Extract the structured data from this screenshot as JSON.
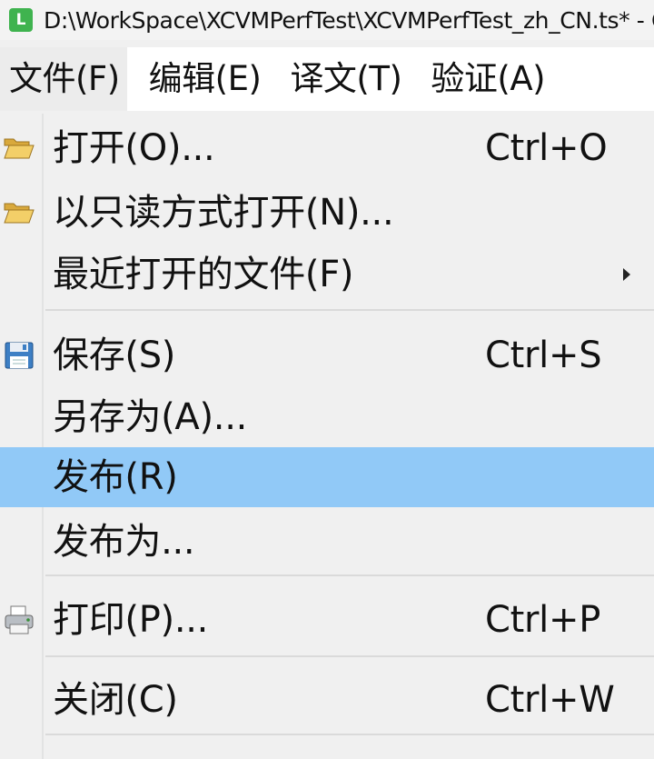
{
  "window": {
    "app_icon_letter": "L",
    "title": "D:\\WorkSpace\\XCVMPerfTest\\XCVMPerfTest_zh_CN.ts* - C"
  },
  "menubar": {
    "items": [
      {
        "label": "文件(F)"
      },
      {
        "label": "编辑(E)"
      },
      {
        "label": "译文(T)"
      },
      {
        "label": "验证(A)"
      }
    ]
  },
  "file_menu": {
    "items": [
      {
        "label": "打开(O)...",
        "shortcut": "Ctrl+O",
        "icon": "folder-open-icon"
      },
      {
        "label": "以只读方式打开(N)...",
        "shortcut": "",
        "icon": "folder-open-icon"
      },
      {
        "label": "最近打开的文件(F)",
        "shortcut": "",
        "icon": "",
        "has_submenu": true
      },
      {
        "label": "保存(S)",
        "shortcut": "Ctrl+S",
        "icon": "save-icon"
      },
      {
        "label": "另存为(A)...",
        "shortcut": "",
        "icon": ""
      },
      {
        "label": "发布(R)",
        "shortcut": "",
        "icon": "",
        "highlighted": true
      },
      {
        "label": "发布为...",
        "shortcut": "",
        "icon": ""
      },
      {
        "label": "打印(P)...",
        "shortcut": "Ctrl+P",
        "icon": "printer-icon"
      },
      {
        "label": "关闭(C)",
        "shortcut": "Ctrl+W",
        "icon": ""
      }
    ]
  },
  "colors": {
    "highlight": "#91c9f7",
    "app_icon": "#3fb34f",
    "menu_background": "#f0f0f0"
  }
}
